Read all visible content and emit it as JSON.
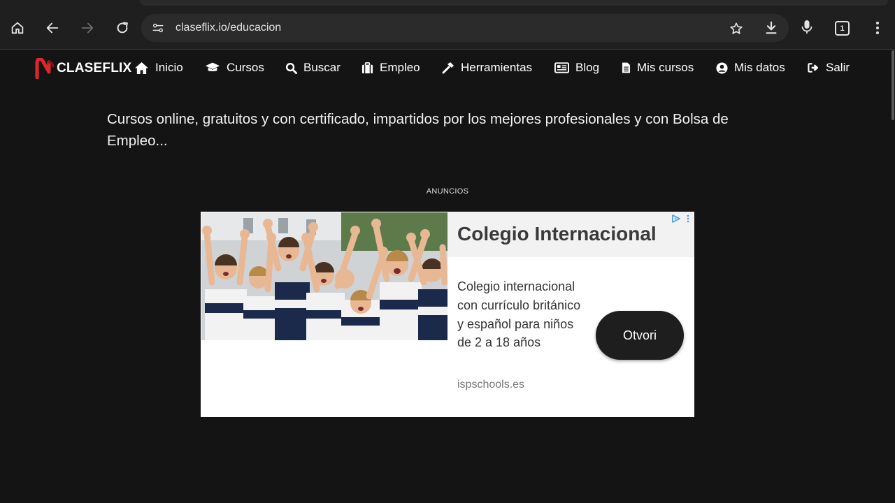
{
  "browser": {
    "url": "claseflix.io/educacion",
    "tab_count": "1"
  },
  "site": {
    "logo_text": "CLASEFLIX",
    "nav": [
      {
        "label": "Inicio",
        "icon": "home-icon"
      },
      {
        "label": "Cursos",
        "icon": "graduation-cap-icon"
      },
      {
        "label": "Buscar",
        "icon": "search-icon"
      },
      {
        "label": "Empleo",
        "icon": "briefcase-icon"
      },
      {
        "label": "Herramientas",
        "icon": "hammer-icon"
      },
      {
        "label": "Blog",
        "icon": "newspaper-icon"
      },
      {
        "label": "Mis cursos",
        "icon": "file-icon"
      },
      {
        "label": "Mis datos",
        "icon": "user-circle-icon"
      },
      {
        "label": "Salir",
        "icon": "sign-out-icon"
      }
    ]
  },
  "main": {
    "headline": "Cursos online, gratuitos y con certificado, impartidos por los mejores profesionales y con Bolsa de Empleo...",
    "ads_label": "ANUNCIOS"
  },
  "ad": {
    "title": "Colegio Internacional",
    "description": "Colegio internacional con currículo británico y español para niños de 2 a 18 años",
    "domain": "ispschools.es",
    "cta": "Otvori"
  },
  "colors": {
    "page_bg": "#141414",
    "chrome_bg": "#1f1f1f",
    "omnibox_bg": "#2b2b2b",
    "logo_red": "#e0262b",
    "ad_choices_blue": "#4da3d9"
  }
}
